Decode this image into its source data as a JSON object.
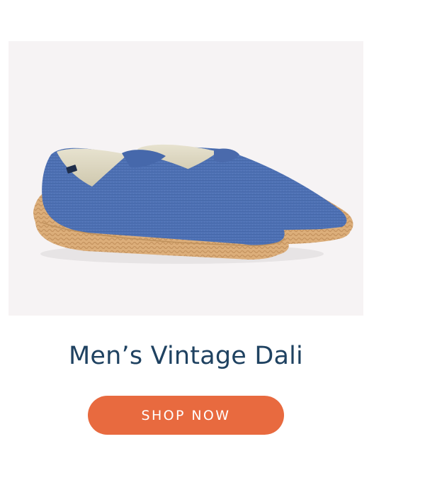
{
  "product": {
    "title": "Men’s Vintage Dali",
    "image_alt": "blue canvas espadrille pair",
    "cta_label": "SHOP NOW"
  },
  "colors": {
    "title": "#1f4261",
    "cta_background": "#e86a3f",
    "cta_text": "#ffffff",
    "image_background": "#f6f3f4",
    "canvas_blue": "#4a6db1",
    "jute_sole": "#d9a873"
  },
  "icons": {
    "product_photo": "espadrille-shoes-image"
  }
}
